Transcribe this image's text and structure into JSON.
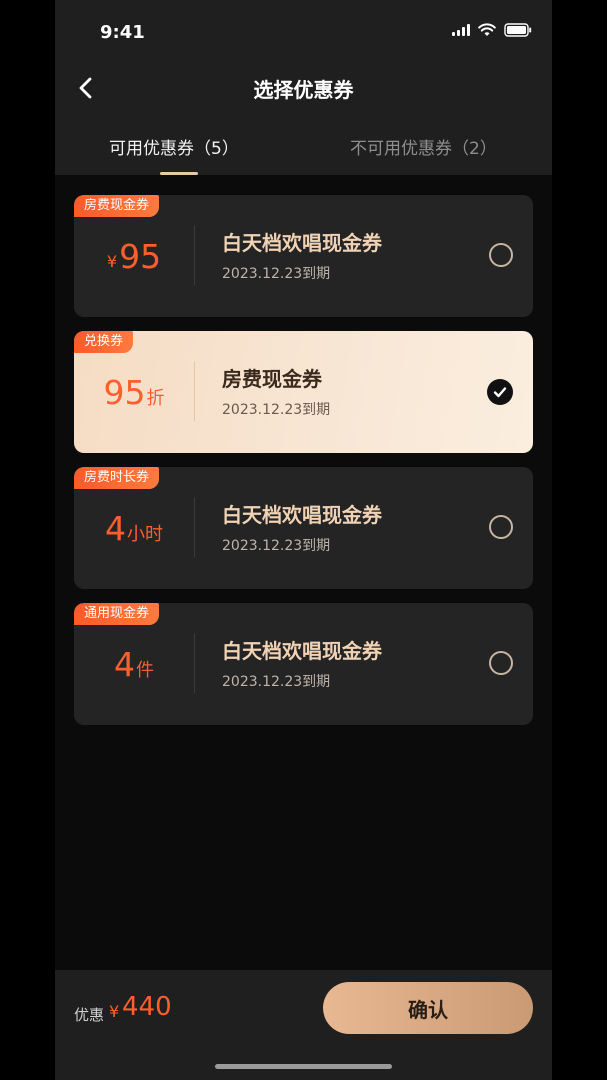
{
  "status_bar": {
    "time": "9:41"
  },
  "nav": {
    "title": "选择优惠券"
  },
  "tabs": [
    {
      "label": "可用优惠券（5）",
      "active": true
    },
    {
      "label": "不可用优惠券（2）",
      "active": false
    }
  ],
  "coupons": [
    {
      "tag": "房费现金券",
      "prefix": "¥",
      "value": "95",
      "suffix": "",
      "title": "白天档欢唱现金券",
      "expiry": "2023.12.23到期",
      "selected": false
    },
    {
      "tag": "兑换券",
      "prefix": "",
      "value": "95",
      "suffix": "折",
      "title": "房费现金券",
      "expiry": "2023.12.23到期",
      "selected": true
    },
    {
      "tag": "房费时长券",
      "prefix": "",
      "value": "4",
      "suffix": "小时",
      "title": "白天档欢唱现金券",
      "expiry": "2023.12.23到期",
      "selected": false
    },
    {
      "tag": "通用现金券",
      "prefix": "",
      "value": "4",
      "suffix": "件",
      "title": "白天档欢唱现金券",
      "expiry": "2023.12.23到期",
      "selected": false
    }
  ],
  "footer": {
    "discount_label": "优惠",
    "currency": "¥",
    "discount_value": "440",
    "confirm_label": "确认"
  },
  "colors": {
    "accent_orange": "#ff5f2e",
    "gold_text": "#f0d2b4",
    "selected_bg": "#f8e6d4"
  }
}
